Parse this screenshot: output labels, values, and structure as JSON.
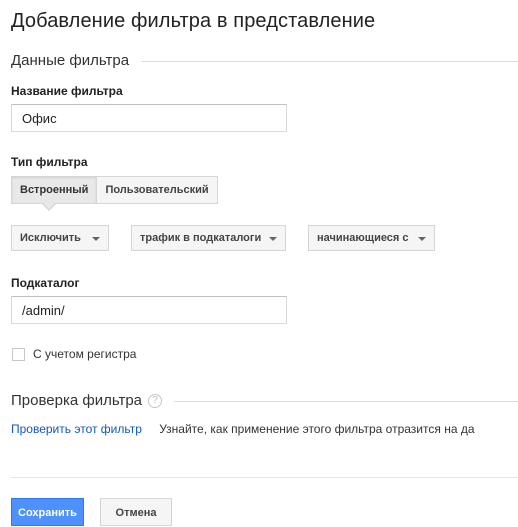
{
  "page": {
    "title": "Добавление фильтра в представление"
  },
  "filter_data": {
    "section_title": "Данные фильтра",
    "name_label": "Название фильтра",
    "name_value": "Офис",
    "type_label": "Тип фильтра",
    "type_options": [
      {
        "label": "Встроенный",
        "selected": true
      },
      {
        "label": "Пользовательский",
        "selected": false
      }
    ],
    "dropdowns": [
      {
        "value": "Исключить"
      },
      {
        "value": "трафик в подкаталоги"
      },
      {
        "value": "начинающиеся с"
      }
    ],
    "subdir_label": "Подкаталог",
    "subdir_value": "/admin/",
    "case_checkbox": {
      "label": "С учетом регистра",
      "checked": false
    }
  },
  "verification": {
    "section_title": "Проверка фильтра",
    "help_icon": "question-mark-icon",
    "verify_link": "Проверить этот фильтр",
    "verify_description": "Узнайте, как применение этого фильтра отразится на да"
  },
  "actions": {
    "save_label": "Сохранить",
    "cancel_label": "Отмена"
  },
  "colors": {
    "primary_button": "#4d90fe",
    "link": "#1155cc"
  }
}
